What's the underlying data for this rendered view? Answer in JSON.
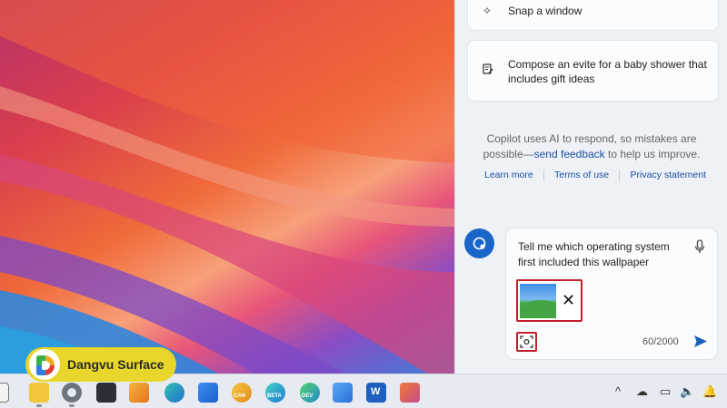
{
  "copilot": {
    "suggestions": [
      {
        "icon": "sparkle-icon",
        "label": "Snap a window"
      },
      {
        "icon": "document-edit-icon",
        "label": "Compose an evite for a baby shower that includes gift ideas"
      }
    ],
    "disclaimer": {
      "text_before": "Copilot uses AI to respond, so mistakes are possible—",
      "link": "send feedback",
      "text_after": " to help us improve."
    },
    "footer_links": [
      "Learn more",
      "Terms of use",
      "Privacy statement"
    ],
    "input": {
      "message": "Tell me which operating system first included this wallpaper",
      "char_count": "60/2000"
    }
  },
  "watermark": {
    "brand": "Dangvu Surface"
  },
  "taskbar": {
    "apps": [
      "file-explorer-icon",
      "settings-icon",
      "terminal-icon",
      "paint-icon",
      "edge-icon",
      "store-icon",
      "edge-canary-icon",
      "edge-beta-icon",
      "edge-dev-icon",
      "photos-icon",
      "word-icon",
      "snipping-icon"
    ],
    "badges": {
      "canary": "CAN",
      "beta": "BETA",
      "dev": "DEV",
      "word": "W"
    },
    "tray": [
      "chevron-up-icon",
      "cloud-icon",
      "display-icon",
      "volume-mute-icon",
      "notification-icon"
    ]
  }
}
